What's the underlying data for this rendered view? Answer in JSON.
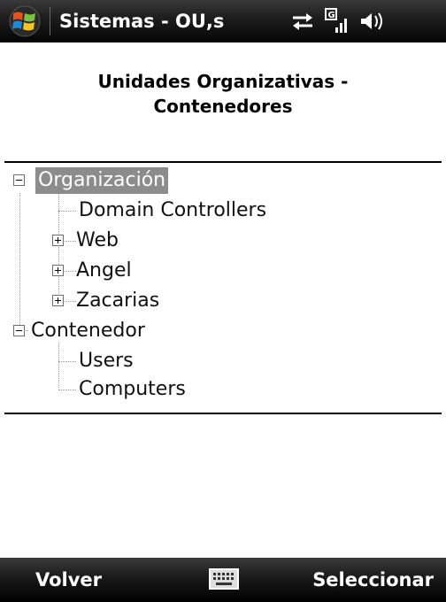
{
  "titlebar": {
    "title": "Sistemas - OU,s",
    "icons": [
      "windows-start-icon",
      "sync-arrows-icon",
      "signal-icon",
      "volume-icon"
    ]
  },
  "header": {
    "title": "Unidades Organizativas - Contenedores"
  },
  "tree": {
    "nodes": [
      {
        "label": "Organización",
        "level": 0,
        "toggle": "minus",
        "selected": true
      },
      {
        "label": "Domain Controllers",
        "level": 1,
        "toggle": "none"
      },
      {
        "label": "Web",
        "level": 1,
        "toggle": "plus"
      },
      {
        "label": "Angel",
        "level": 1,
        "toggle": "plus"
      },
      {
        "label": "Zacarias",
        "level": 1,
        "toggle": "plus"
      },
      {
        "label": "Contenedor",
        "level": 0,
        "toggle": "minus",
        "selected": false
      },
      {
        "label": "Users",
        "level": 1,
        "toggle": "none"
      },
      {
        "label": "Computers",
        "level": 1,
        "toggle": "none"
      }
    ]
  },
  "softkeys": {
    "left": "Volver",
    "right": "Seleccionar",
    "center_icon": "keyboard-icon"
  },
  "colors": {
    "selection": "#8c8c8c",
    "bar": "#1e1e1e"
  }
}
